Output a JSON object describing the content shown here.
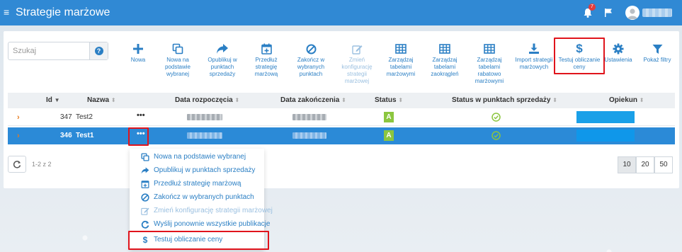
{
  "app": {
    "title": "Strategie marżowe",
    "notification_count": "7",
    "colors": {
      "topbar": "#3089d4",
      "accent": "#2b7fc4",
      "selected_row": "#2b8ad7",
      "highlight": "#e0141c",
      "status_ok": "#8cc63f"
    }
  },
  "search": {
    "placeholder": "Szukaj",
    "value": ""
  },
  "toolbar": [
    {
      "label": "Nowa",
      "icon": "plus-icon",
      "enabled": true
    },
    {
      "label": "Nowa na podstawie wybranej",
      "icon": "copy-icon",
      "enabled": true
    },
    {
      "label": "Opublikuj w punktach sprzedaży",
      "icon": "share-icon",
      "enabled": true
    },
    {
      "label": "Przedłuż strategię marżową",
      "icon": "calendar-plus-icon",
      "enabled": true
    },
    {
      "label": "Zakończ w wybranych punktach",
      "icon": "ban-icon",
      "enabled": true
    },
    {
      "label": "Zmień konfigurację strategii marżowej",
      "icon": "edit-icon",
      "enabled": false
    },
    {
      "label": "Zarządzaj tabelami marżowymi",
      "icon": "table-icon",
      "enabled": true
    },
    {
      "label": "Zarządzaj tabelami zaokrągleń",
      "icon": "table-icon",
      "enabled": true
    },
    {
      "label": "Zarządzaj tabelami rabatowo marżowymi",
      "icon": "table-icon",
      "enabled": true
    },
    {
      "label": "Import strategii marżowych",
      "icon": "download-icon",
      "enabled": true
    },
    {
      "label": "Testuj obliczanie ceny",
      "icon": "dollar-icon",
      "enabled": true
    },
    {
      "label": "Ustawienia",
      "icon": "gear-icon",
      "enabled": true
    },
    {
      "label": "Pokaż filtry",
      "icon": "filter-icon",
      "enabled": true
    }
  ],
  "table": {
    "columns": {
      "id": "Id",
      "name": "Nazwa",
      "start": "Data rozpoczęcia",
      "end": "Data zakończenia",
      "status": "Status",
      "status_pos": "Status w punktach sprzedaży",
      "owner": "Opiekun"
    },
    "rows": [
      {
        "id": "347",
        "name": "Test2",
        "status": "A",
        "menu": "•••"
      },
      {
        "id": "346",
        "name": "Test1",
        "status": "A",
        "menu": "•••"
      }
    ]
  },
  "pagination": {
    "info": "1-2 z 2",
    "sizes": [
      "10",
      "20",
      "50"
    ],
    "active_size": "10"
  },
  "context_menu": [
    {
      "label": "Nowa na podstawie wybranej",
      "icon": "copy-icon",
      "enabled": true
    },
    {
      "label": "Opublikuj w punktach sprzedaży",
      "icon": "share-icon",
      "enabled": true
    },
    {
      "label": "Przedłuż strategię marżową",
      "icon": "calendar-plus-icon",
      "enabled": true
    },
    {
      "label": "Zakończ w wybranych punktach",
      "icon": "ban-icon",
      "enabled": true
    },
    {
      "label": "Zmień konfigurację strategii marżowej",
      "icon": "edit-icon",
      "enabled": false
    },
    {
      "label": "Wyślij ponownie wszystkie publikacje",
      "icon": "redo-icon",
      "enabled": true
    },
    {
      "label": "Testuj obliczanie ceny",
      "icon": "dollar-icon",
      "enabled": true
    }
  ]
}
